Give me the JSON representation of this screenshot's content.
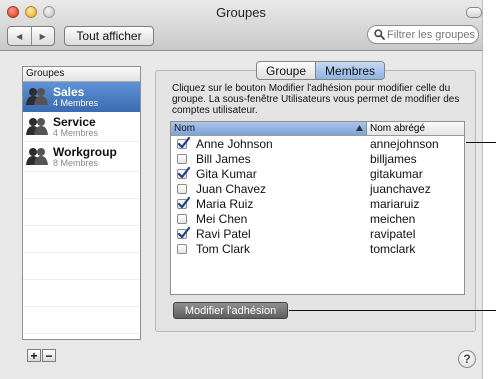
{
  "window": {
    "title": "Groupes"
  },
  "toolbar": {
    "back": "◀",
    "forward": "▶",
    "show_all_label": "Tout afficher",
    "search_placeholder": "Filtrer les groupes"
  },
  "sidebar": {
    "header": "Groupes",
    "groups": [
      {
        "name": "Sales",
        "count": "4 Membres",
        "selected": true
      },
      {
        "name": "Service",
        "count": "4 Membres",
        "selected": false
      },
      {
        "name": "Workgroup",
        "count": "8 Membres",
        "selected": false
      }
    ],
    "add_label": "+",
    "remove_label": "−"
  },
  "tabs": [
    {
      "label": "Groupe",
      "selected": false
    },
    {
      "label": "Membres",
      "selected": true
    }
  ],
  "description": "Cliquez sur le bouton Modifier l'adhésion pour modifier celle du groupe. La sous-fenêtre Utilisateurs vous permet de modifier des comptes utilisateur.",
  "members_table": {
    "columns": [
      "Nom",
      "Nom abrégé"
    ],
    "rows": [
      {
        "name": "Anne Johnson",
        "short": "annejohnson",
        "checked": true
      },
      {
        "name": "Bill James",
        "short": "billjames",
        "checked": false
      },
      {
        "name": "Gita Kumar",
        "short": "gitakumar",
        "checked": true
      },
      {
        "name": "Juan Chavez",
        "short": "juanchavez",
        "checked": false
      },
      {
        "name": "Maria Ruiz",
        "short": "mariaruiz",
        "checked": true
      },
      {
        "name": "Mei Chen",
        "short": "meichen",
        "checked": false
      },
      {
        "name": "Ravi Patel",
        "short": "ravipatel",
        "checked": true
      },
      {
        "name": "Tom Clark",
        "short": "tomclark",
        "checked": false
      }
    ]
  },
  "modify_button_label": "Modifier l'adhésion",
  "help_label": "?",
  "colors": {
    "selection": "#3d6cb4",
    "checkmark": "#1d3f8f",
    "panel": "#e3e3e3"
  }
}
